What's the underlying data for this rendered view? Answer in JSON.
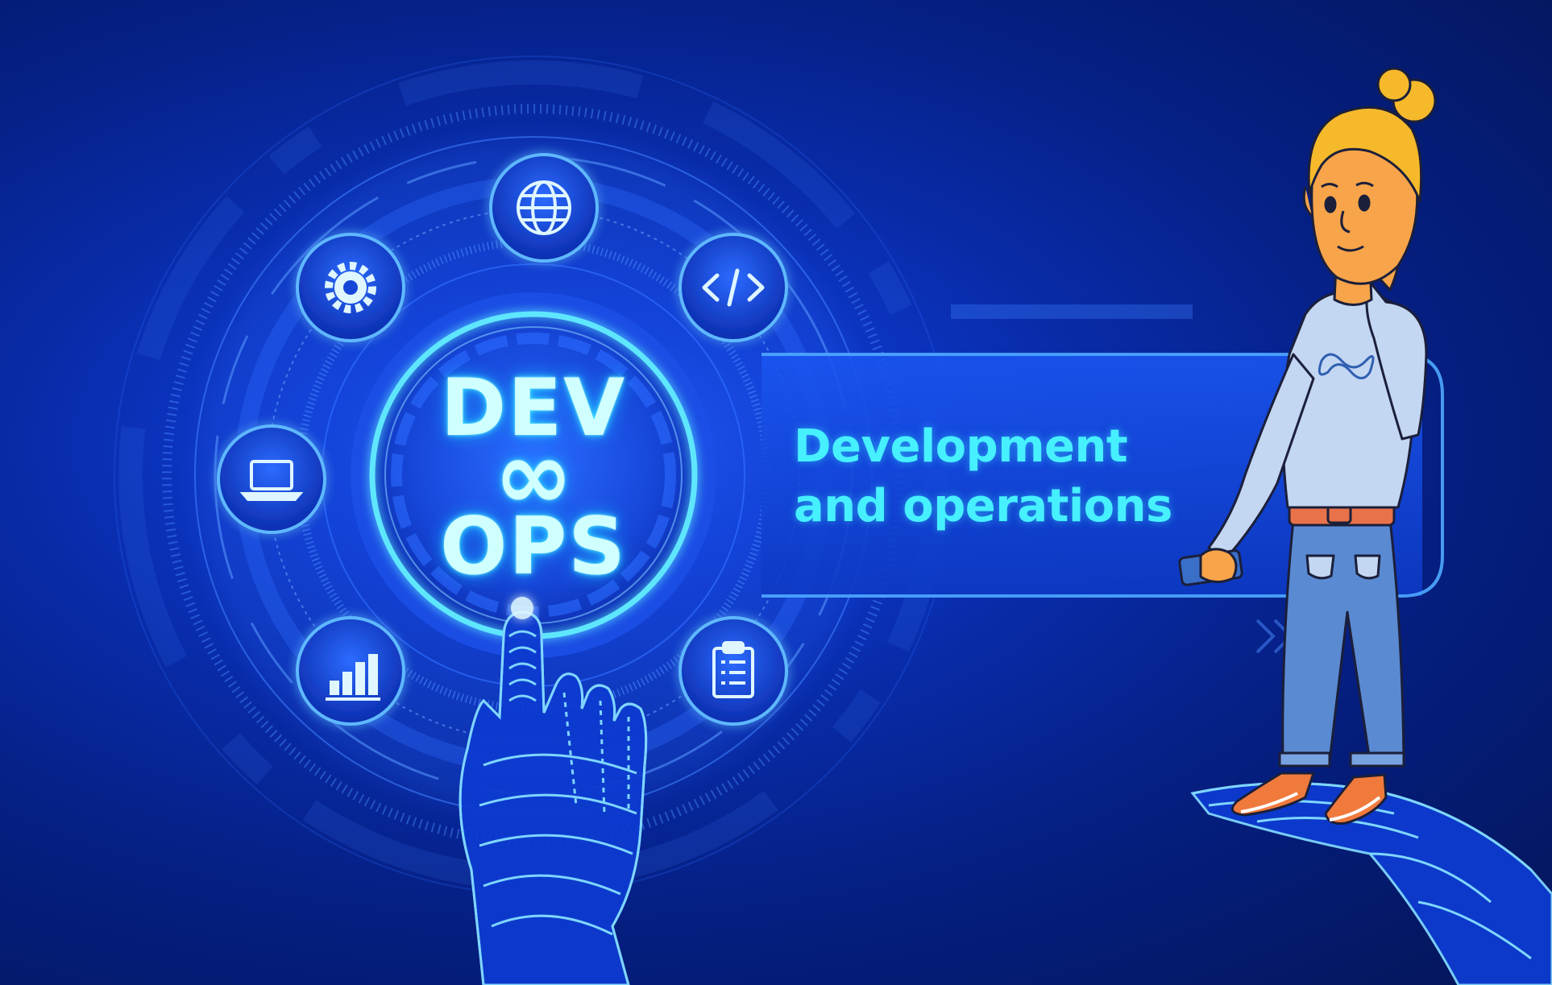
{
  "hub": {
    "line1": "DEV",
    "symbol": "∞",
    "line2": "OPS"
  },
  "caption": {
    "line1": "Development",
    "line2": "and operations"
  },
  "icons": [
    "globe-icon",
    "code-icon",
    "clipboard-icon",
    "bar-chart-icon",
    "laptop-icon",
    "gear-icon"
  ],
  "colors": {
    "background": "#0a2fb5",
    "glow": "#3fe9ff",
    "text_cyan": "#46f0ff",
    "hair": "#f5b92b",
    "sweater": "#c3d6f2",
    "jeans": "#5a8ad2",
    "belt": "#e8724a",
    "shoes": "#f07a3c"
  }
}
